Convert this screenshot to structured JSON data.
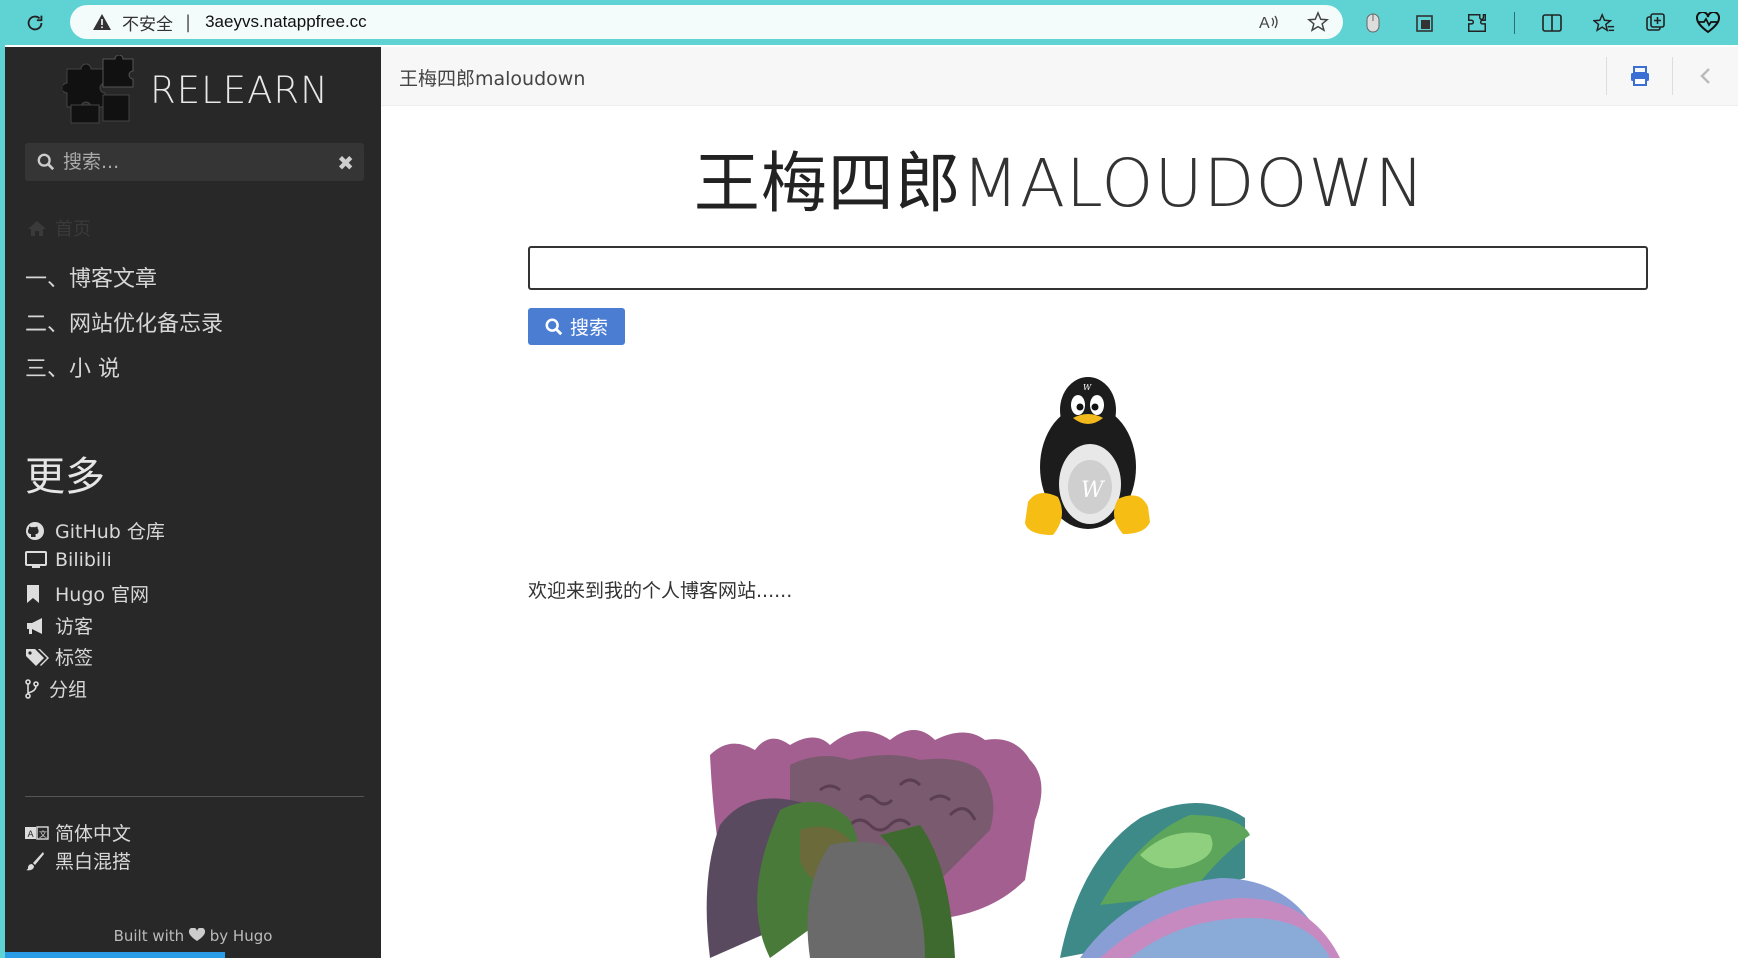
{
  "browser": {
    "insecure_label": "不安全",
    "url": "3aeyvs.natappfree.cc"
  },
  "sidebar": {
    "logo_text": "RELEARN",
    "search_placeholder": "搜索...",
    "home_label": "首页",
    "nav": [
      {
        "label": "一、博客文章"
      },
      {
        "label": "二、网站优化备忘录"
      },
      {
        "label": "三、小 说"
      }
    ],
    "more_title": "更多",
    "more_links": [
      {
        "label": "GitHub 仓库",
        "icon": "github-icon"
      },
      {
        "label": "Bilibili",
        "icon": "monitor-icon"
      },
      {
        "label": "Hugo 官网",
        "icon": "bookmark-icon"
      },
      {
        "label": "访客",
        "icon": "megaphone-icon"
      },
      {
        "label": "标签",
        "icon": "tags-icon"
      },
      {
        "label": "分组",
        "icon": "branch-icon"
      }
    ],
    "language": "简体中文",
    "theme": "黑白混搭",
    "footer": {
      "built_with": "Built with",
      "by": "by Hugo"
    }
  },
  "topbar": {
    "breadcrumb": "王梅四郎maloudown"
  },
  "main": {
    "title_cn": "王梅四郎",
    "title_latin": "MALOUDOWN",
    "search_button": "搜索",
    "welcome": "欢迎来到我的个人博客网站......"
  },
  "colors": {
    "browser_accent": "#5fd3d3",
    "sidebar_bg": "#282828",
    "button_blue": "#4b7dd3"
  }
}
